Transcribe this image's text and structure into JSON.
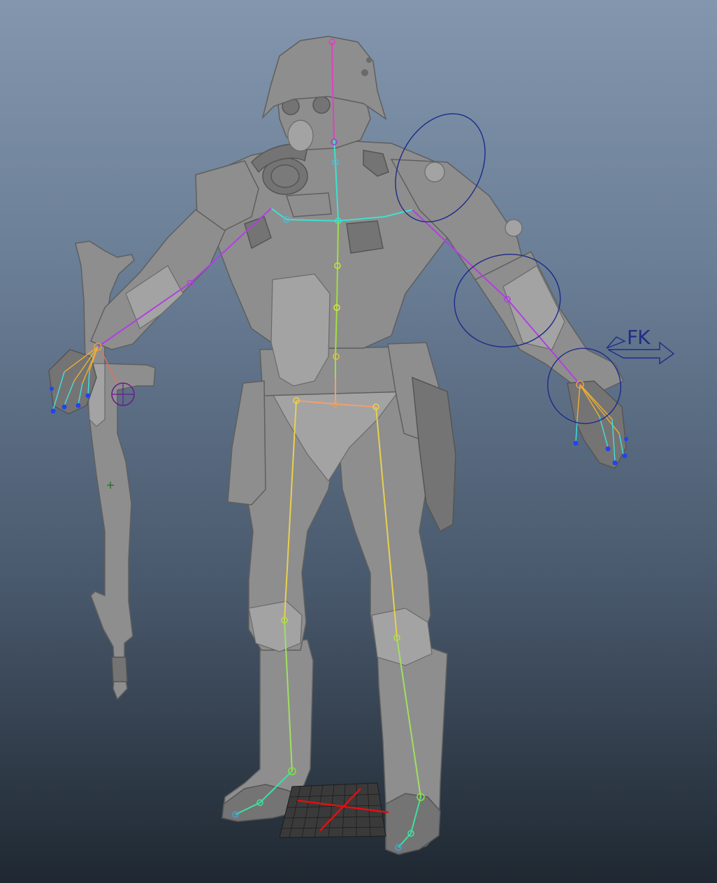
{
  "viewport": {
    "background_top": "#8396ad",
    "background_bottom": "#1f2831",
    "mesh_color": "#8e8e8e"
  },
  "rig": {
    "fk_ik_switch_label": "FK",
    "spine_color": "#e040c0",
    "leg_color": "#e8d050",
    "arm_color": "#b040e0",
    "control_color": "#1d2a8a",
    "grid_axis_color": "#e01010"
  },
  "icons": {
    "fk_switch": "fk-arrow-icon",
    "ground_grid": "ground-grid-icon"
  }
}
